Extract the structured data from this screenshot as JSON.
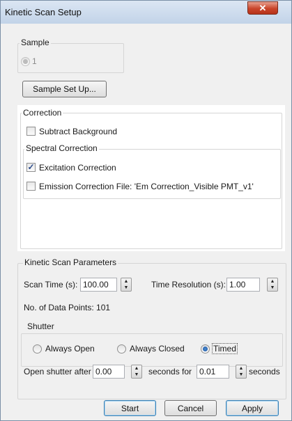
{
  "window": {
    "title": "Kinetic Scan Setup",
    "close_glyph": "✕"
  },
  "sample": {
    "legend": "Sample",
    "option_label": "1",
    "selected": true,
    "disabled": true
  },
  "sample_setup_button": "Sample Set Up...",
  "correction": {
    "legend": "Correction",
    "subtract_background": {
      "label": "Subtract Background",
      "checked": false
    },
    "spectral": {
      "legend": "Spectral Correction",
      "excitation": {
        "label": "Excitation Correction",
        "checked": true
      },
      "emission": {
        "label": "Emission Correction File: 'Em Correction_Visible PMT_v1'",
        "checked": false
      }
    }
  },
  "kinetic": {
    "legend": "Kinetic Scan Parameters",
    "scan_time": {
      "label": "Scan Time (s):",
      "value": "100.00"
    },
    "time_resolution": {
      "label": "Time Resolution (s):",
      "value": "1.00"
    },
    "data_points_label": "No. of Data Points: 101",
    "shutter": {
      "legend": "Shutter",
      "options": [
        {
          "label": "Always Open",
          "selected": false
        },
        {
          "label": "Always Closed",
          "selected": false
        },
        {
          "label": "Timed",
          "selected": true
        }
      ],
      "open_after_label": "Open shutter after",
      "open_after_value": "0.00",
      "seconds_for_label": "seconds for",
      "duration_value": "0.01",
      "seconds_label": "seconds"
    }
  },
  "buttons": {
    "start": "Start",
    "cancel": "Cancel",
    "apply": "Apply"
  },
  "icons": {
    "checkmark": "check-icon",
    "spin_up": "▲",
    "spin_down": "▼"
  }
}
